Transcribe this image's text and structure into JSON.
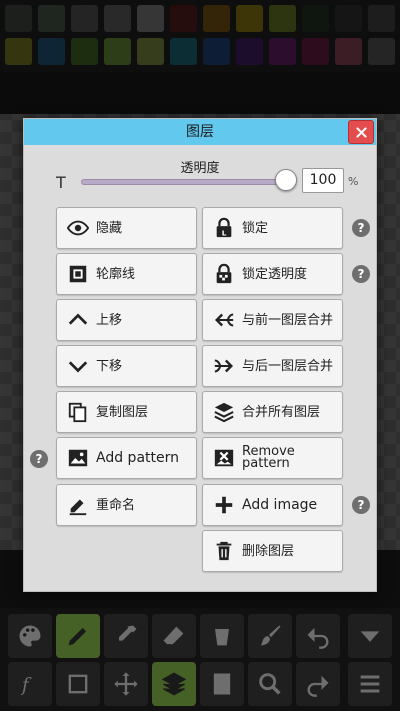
{
  "dialog": {
    "title": "图层",
    "close_label": "✕",
    "opacity": {
      "label": "透明度",
      "text_glyph": "T",
      "value": "100",
      "value_fraction": 1.0,
      "unit": "%"
    },
    "buttons": {
      "hide": "隐藏",
      "lock": "锁定",
      "outline": "轮廓线",
      "lock_transparency": "锁定透明度",
      "move_up": "上移",
      "merge_previous": "与前一图层合并",
      "move_down": "下移",
      "merge_next": "与后一图层合并",
      "duplicate_layer": "复制图层",
      "merge_all": "合并所有图层",
      "add_pattern": "Add pattern",
      "remove_pattern_line1": "Remove",
      "remove_pattern_line2": "pattern",
      "rename": "重命名",
      "add_image": "Add image",
      "delete_layer": "删除图层"
    },
    "help_glyph": "?"
  },
  "colors": {
    "header": "#62c8ee",
    "close": "#e34d4d",
    "dialog_bg": "#dcdcdc",
    "button_bg": "#f4f4f4",
    "active_tool": "#8bc34a"
  },
  "toolbar": {
    "icons": [
      "palette-icon",
      "pencil-icon",
      "eyedropper-icon",
      "eraser-icon",
      "bucket-icon",
      "brush-icon",
      "undo-icon",
      "dropdown-icon",
      "function-icon",
      "selection-icon",
      "move-icon",
      "layers-icon",
      "film-icon",
      "zoom-icon",
      "redo-icon",
      "menu-icon"
    ]
  }
}
